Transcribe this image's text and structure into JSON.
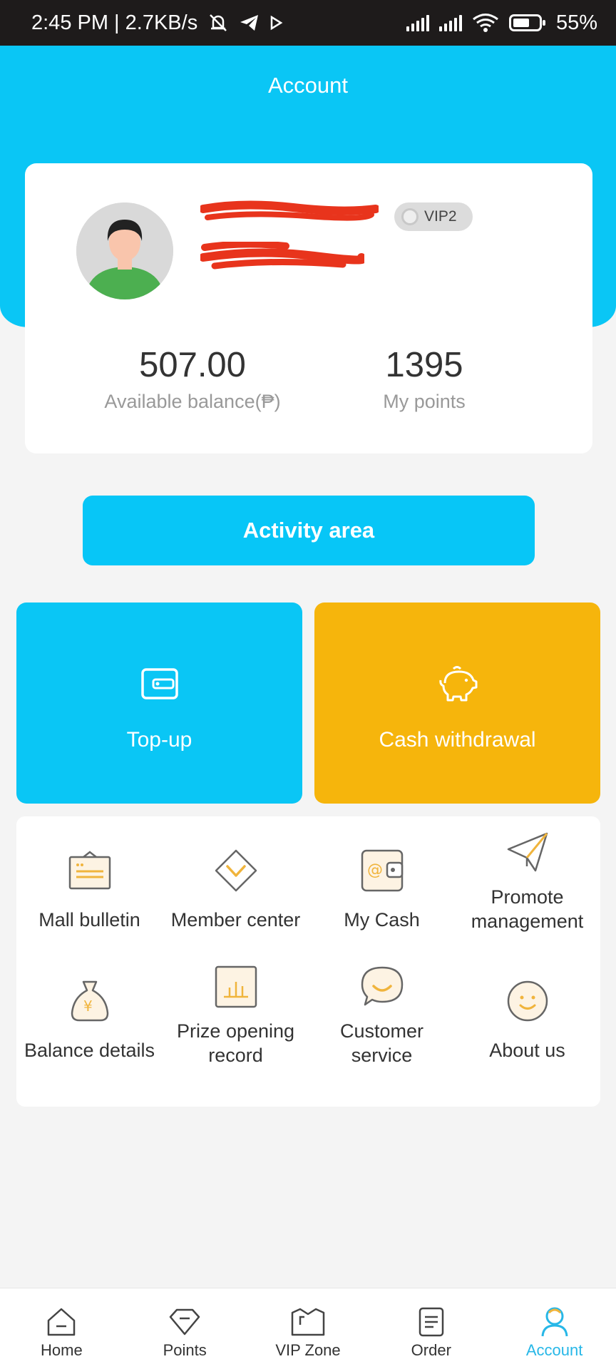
{
  "status_bar": {
    "time_speed": "2:45 PM | 2.7KB/s",
    "battery": "55%"
  },
  "header": {
    "title": "Account"
  },
  "profile": {
    "vip_level": "VIP2",
    "balance_value": "507.00",
    "balance_label": "Available balance(₱)",
    "points_value": "1395",
    "points_label": "My points"
  },
  "activity": {
    "label": "Activity area"
  },
  "tiles": {
    "topup": "Top-up",
    "cash_withdrawal": "Cash withdrawal"
  },
  "menu": {
    "items": [
      {
        "label": "Mall bulletin",
        "icon": "bulletin-board-icon"
      },
      {
        "label": "Member center",
        "icon": "diamond-chevron-icon"
      },
      {
        "label": "My Cash",
        "icon": "wallet-icon"
      },
      {
        "label": "Promote management",
        "icon": "paper-plane-icon"
      },
      {
        "label": "Balance details",
        "icon": "money-bag-icon"
      },
      {
        "label": "Prize opening record",
        "icon": "bar-chart-icon"
      },
      {
        "label": "Customer service",
        "icon": "chat-smile-icon"
      },
      {
        "label": "About us",
        "icon": "smiley-icon"
      }
    ]
  },
  "nav": {
    "items": [
      {
        "label": "Home"
      },
      {
        "label": "Points"
      },
      {
        "label": "VIP Zone"
      },
      {
        "label": "Order"
      },
      {
        "label": "Account"
      }
    ],
    "active_index": 4
  },
  "colors": {
    "primary": "#0AC6F5",
    "accent_orange": "#F6B50C",
    "icon_orange": "#F0B43C",
    "redaction": "#E8341C"
  }
}
